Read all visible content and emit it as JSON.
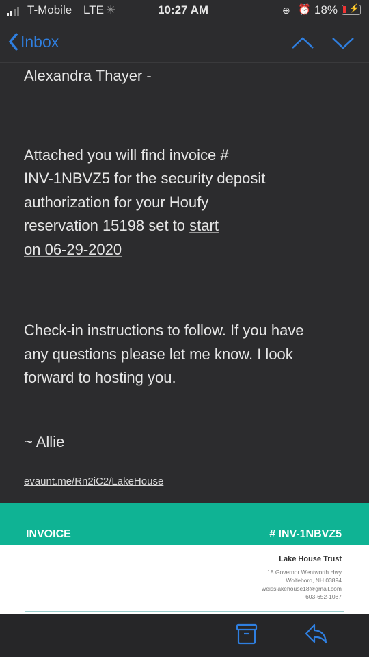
{
  "status_bar": {
    "carrier": "T-Mobile",
    "network": "LTE",
    "time": "10:27 AM",
    "battery": "18%",
    "battery_level": 0.18,
    "icons": [
      "signal-icon",
      "activity-spinner-icon",
      "rotation-lock-icon",
      "alarm-icon",
      "battery-charging-icon"
    ]
  },
  "nav": {
    "back_label": "Inbox",
    "accent": "#2f7fe0"
  },
  "email": {
    "greeting": "Alexandra Thayer -",
    "para1_line1": "Attached you will find invoice #",
    "para1_line2": "INV-1NBVZ5 for the security deposit",
    "para1_line3": "authorization for your Houfy",
    "para1_line4_pre": "reservation 15198 set to ",
    "para1_line4_link": "start",
    "para1_line5": "on 06-29-2020",
    "para2_line1": "Check-in instructions to follow. If you have",
    "para2_line2": "any questions please let me know. I look",
    "para2_line3": "forward to hosting you.",
    "signoff": "~ Allie",
    "link": "evaunt.me/Rn2iC2/LakeHouse"
  },
  "invoice": {
    "title": "INVOICE",
    "number": "# INV-1NBVZ5",
    "color": "#0fb394",
    "company": "Lake House Trust",
    "address1": "18 Governor Wentworth Hwy",
    "address2": "Wolfeboro, NH 03894",
    "email": "weisslakehouse18@gmail.com",
    "phone": "603-652-1087"
  }
}
